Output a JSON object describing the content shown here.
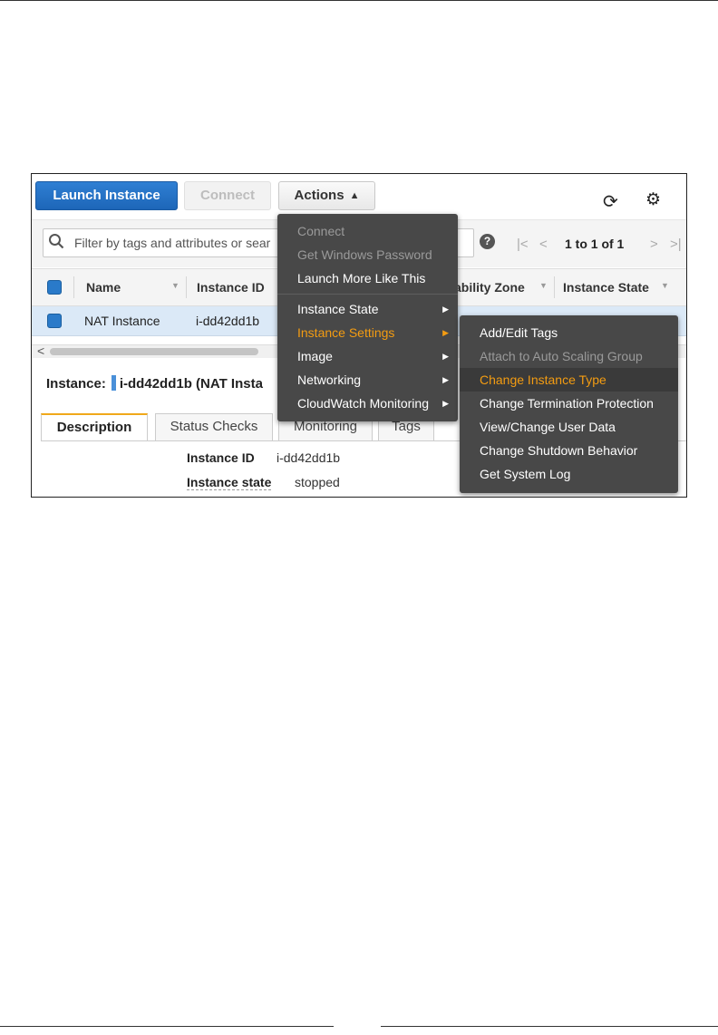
{
  "toolbar": {
    "launch_label": "Launch Instance",
    "connect_label": "Connect",
    "actions_label": "Actions",
    "actions_caret": "^"
  },
  "filter": {
    "placeholder": "Filter by tags and attributes or sear"
  },
  "pager": {
    "text": "1 to 1 of 1"
  },
  "table": {
    "columns": [
      "Name",
      "Instance ID",
      "ability Zone",
      "Instance State"
    ],
    "rows": [
      {
        "name": "NAT Instance",
        "instance_id": "i-dd42dd1b"
      }
    ]
  },
  "instance": {
    "label": "Instance:",
    "title": "i-dd42dd1b (NAT Insta"
  },
  "tabs": [
    "Description",
    "Status Checks",
    "Monitoring",
    "Tags"
  ],
  "details": [
    {
      "label": "Instance ID",
      "value": "i-dd42dd1b"
    },
    {
      "label": "Instance state",
      "value": "stopped"
    }
  ],
  "actions_menu": {
    "items": [
      {
        "label": "Connect",
        "state": "disabled"
      },
      {
        "label": "Get Windows Password",
        "state": "disabled"
      },
      {
        "label": "Launch More Like This",
        "state": "normal"
      },
      {
        "label": "Instance State",
        "state": "normal",
        "submenu": true
      },
      {
        "label": "Instance Settings",
        "state": "active",
        "submenu": true
      },
      {
        "label": "Image",
        "state": "normal",
        "submenu": true
      },
      {
        "label": "Networking",
        "state": "normal",
        "submenu": true
      },
      {
        "label": "CloudWatch Monitoring",
        "state": "normal",
        "submenu": true
      }
    ]
  },
  "settings_submenu": {
    "items": [
      {
        "label": "Add/Edit Tags",
        "state": "normal"
      },
      {
        "label": "Attach to Auto Scaling Group",
        "state": "disabled"
      },
      {
        "label": "Change Instance Type",
        "state": "highlighted"
      },
      {
        "label": "Change Termination Protection",
        "state": "normal"
      },
      {
        "label": "View/Change User Data",
        "state": "normal"
      },
      {
        "label": "Change Shutdown Behavior",
        "state": "normal"
      },
      {
        "label": "Get System Log",
        "state": "normal"
      }
    ]
  },
  "icons": {
    "search": "search-icon",
    "help": "help-icon",
    "refresh": "refresh-icon",
    "settings": "gear-icon"
  },
  "colors": {
    "primary_button": "#1d66b8",
    "menu_background": "#484848",
    "menu_active_text": "#f39c12",
    "selected_row": "#dbe9f7",
    "tab_accent": "#f0a81a"
  }
}
